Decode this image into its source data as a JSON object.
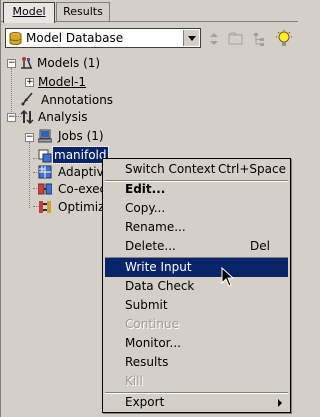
{
  "tabs": [
    {
      "label": "Model",
      "active": true
    },
    {
      "label": "Results",
      "active": false
    }
  ],
  "toolbar": {
    "database_value": "Model Database",
    "buttons": [
      "up-icon",
      "down-icon",
      "folder-icon",
      "filter-icon",
      "lightbulb-icon"
    ]
  },
  "tree": {
    "models": "Models (1)",
    "model1": "Model-1",
    "annotations": "Annotations",
    "analysis": "Analysis",
    "jobs": "Jobs (1)",
    "job_selected": "manifold",
    "adaptivity": "Adaptiv",
    "coexec": "Co-exec",
    "optimization": "Optimiz"
  },
  "context_menu": {
    "switch_context": "Switch Context",
    "switch_context_shortcut": "Ctrl+Space",
    "edit": "Edit...",
    "copy": "Copy...",
    "rename": "Rename...",
    "delete": "Delete...",
    "delete_shortcut": "Del",
    "write_input": "Write Input",
    "data_check": "Data Check",
    "submit": "Submit",
    "continue": "Continue",
    "monitor": "Monitor...",
    "results": "Results",
    "kill": "Kill",
    "export": "Export"
  },
  "colors": {
    "selection": "#0a246a",
    "background": "#d4d0c8"
  }
}
